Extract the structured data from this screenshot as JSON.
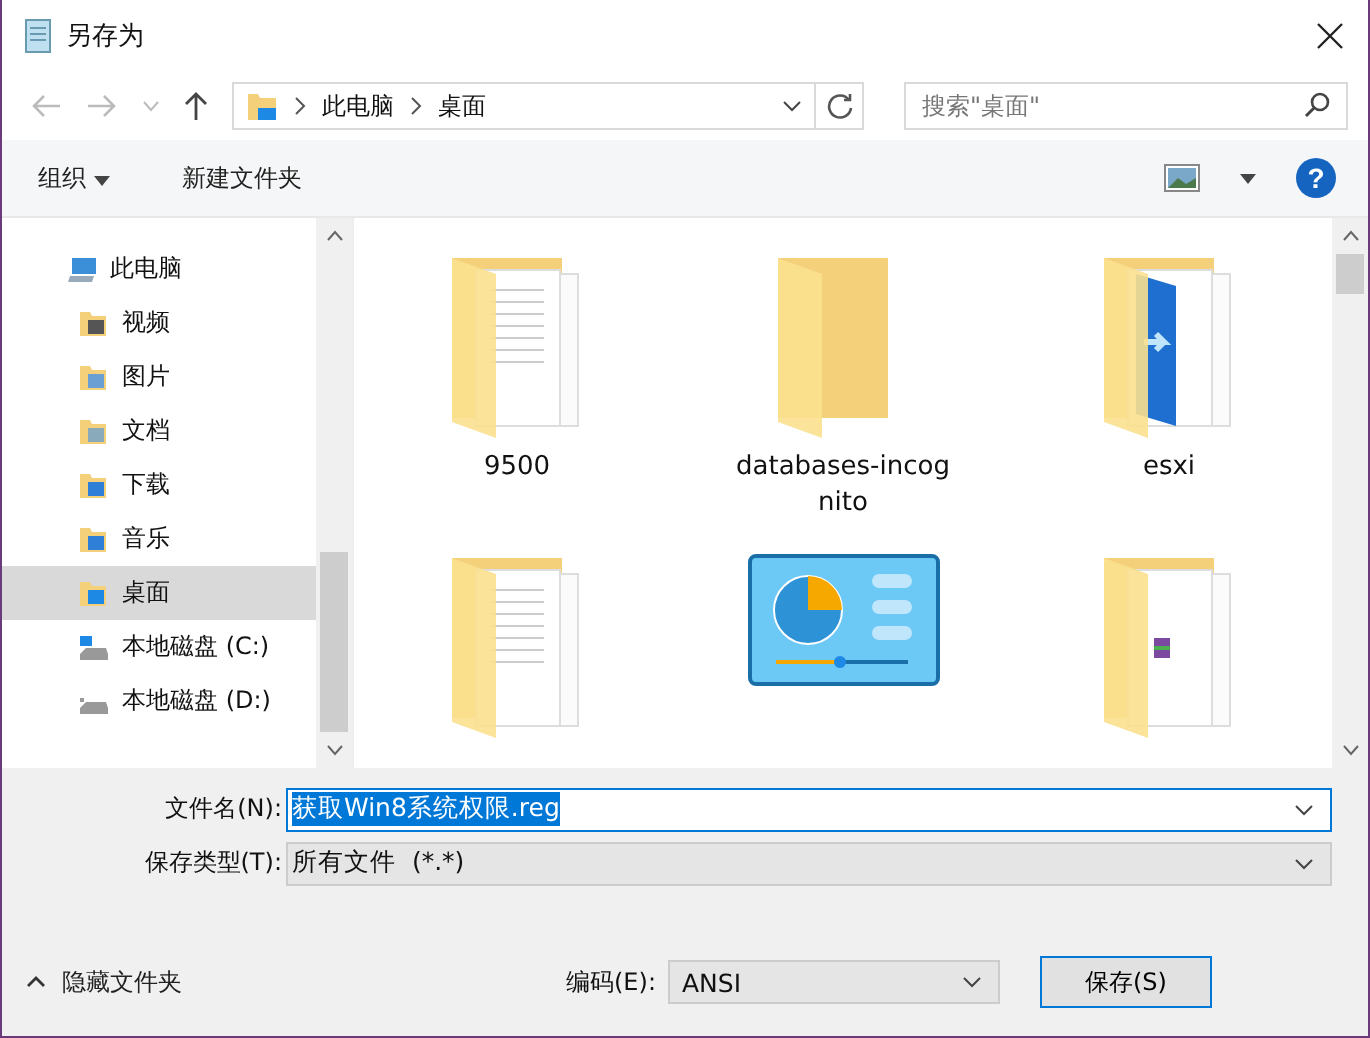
{
  "window": {
    "title": "另存为"
  },
  "nav": {
    "breadcrumb": [
      "此电脑",
      "桌面"
    ],
    "search": {
      "placeholder": "搜索\"桌面\""
    }
  },
  "toolbar": {
    "organize": "组织",
    "new_folder": "新建文件夹",
    "help": "?"
  },
  "sidebar": {
    "items": [
      {
        "label": "此电脑",
        "kind": "pc",
        "selected": false,
        "children": [
          {
            "label": "视频",
            "kind": "video",
            "selected": false
          },
          {
            "label": "图片",
            "kind": "pictures",
            "selected": false
          },
          {
            "label": "文档",
            "kind": "docs",
            "selected": false
          },
          {
            "label": "下载",
            "kind": "downloads",
            "selected": false
          },
          {
            "label": "音乐",
            "kind": "music",
            "selected": false
          },
          {
            "label": "桌面",
            "kind": "desktop",
            "selected": true
          },
          {
            "label": "本地磁盘 (C:)",
            "kind": "drive-c",
            "selected": false
          },
          {
            "label": "本地磁盘 (D:)",
            "kind": "drive",
            "selected": false
          }
        ]
      }
    ]
  },
  "files": [
    {
      "name": "9500",
      "kind": "folder-docs"
    },
    {
      "name": "databases-incognito",
      "kind": "folder"
    },
    {
      "name": "esxi",
      "kind": "folder-app"
    },
    {
      "kind": "folder-docs"
    },
    {
      "kind": "control-panel"
    },
    {
      "kind": "folder-archive"
    }
  ],
  "form": {
    "filename_label": "文件名(N):",
    "filename": "获取Win8系统权限.reg",
    "type_label": "保存类型(T):",
    "type": "所有文件  (*.*)",
    "encoding_label": "编码(E):",
    "encoding": "ANSI",
    "hide_folders": "隐藏文件夹",
    "save": "保存(S)"
  }
}
